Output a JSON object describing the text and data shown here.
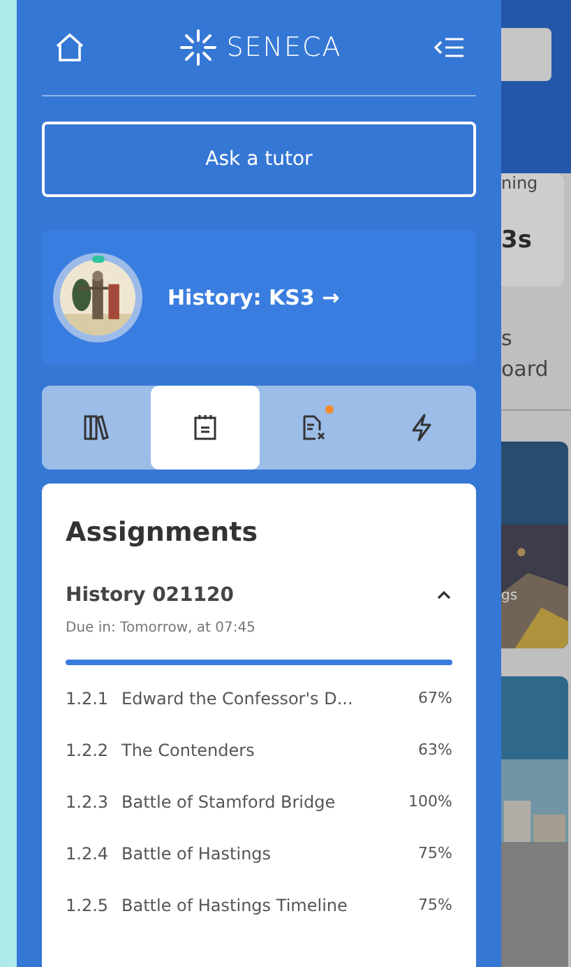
{
  "sidebar": {
    "logo": "SENECA",
    "tutor_button": "Ask a tutor",
    "course": {
      "title": "History: KS3 →"
    },
    "tabs": [
      {
        "kind": "library",
        "selected": false,
        "badge": false
      },
      {
        "kind": "assignments",
        "selected": true,
        "badge": false
      },
      {
        "kind": "wrong-answers",
        "selected": false,
        "badge": true
      },
      {
        "kind": "bolt",
        "selected": false,
        "badge": false
      }
    ],
    "panel": {
      "title": "Assignments",
      "assignment": {
        "title": "History 021120",
        "due": "Due in: Tomorrow, at 07:45",
        "expanded": true,
        "level": 1,
        "items": [
          {
            "number": "1.2.1",
            "title": "Edward the Confessor's D...",
            "percent": "67%"
          },
          {
            "number": "1.2.2",
            "title": "The Contenders",
            "percent": "63%"
          },
          {
            "number": "1.2.3",
            "title": "Battle of Stamford Bridge",
            "percent": "100%"
          },
          {
            "number": "1.2.4",
            "title": "Battle of Hastings",
            "percent": "75%"
          },
          {
            "number": "1.2.5",
            "title": "Battle of Hastings Timeline",
            "percent": "75%"
          }
        ]
      }
    }
  },
  "background": {
    "stat_label": "ning",
    "stat_value": "3s",
    "link_line_1": "s",
    "link_line_2": "oard",
    "card_caption": "gs"
  }
}
